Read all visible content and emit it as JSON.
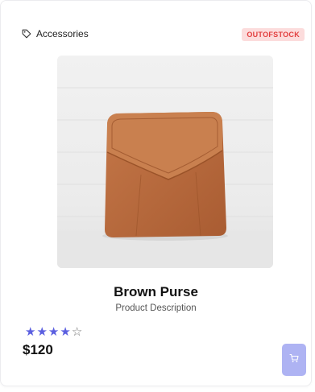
{
  "product": {
    "category": "Accessories",
    "stock_status": "OUTOFSTOCK",
    "name": "Brown Purse",
    "description": "Product Description",
    "rating": 4,
    "rating_max": 5,
    "price": "$120"
  },
  "icons": {
    "category": "tag-icon",
    "cart": "cart-icon",
    "rating": "star-icon"
  },
  "colors": {
    "accent": "#5b5fe0",
    "cart_button": "#aeb3f3",
    "badge_bg": "#fcdcdc",
    "badge_text": "#e23e3e",
    "purse": "#b86b3f"
  }
}
